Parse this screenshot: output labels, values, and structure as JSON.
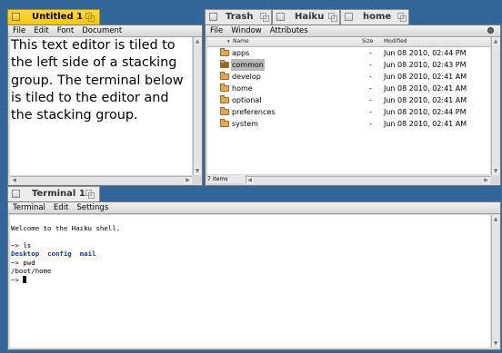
{
  "editor": {
    "tab_title": "Untitled 1",
    "menu": [
      "File",
      "Edit",
      "Font",
      "Document"
    ],
    "text": "This text editor is tiled to the left side of a stacking group. The terminal below is tiled to the editor and the stacking group."
  },
  "tracker": {
    "tabs": [
      "Trash",
      "Haiku",
      "home"
    ],
    "menu": [
      "File",
      "Window",
      "Attributes"
    ],
    "columns": {
      "name": "Name",
      "size": "Size",
      "modified": "Modified"
    },
    "rows": [
      {
        "name": "apps",
        "size": "-",
        "modified": "Jun 08 2010, 02:44 PM",
        "selected": false
      },
      {
        "name": "common",
        "size": "-",
        "modified": "Jun 08 2010, 02:43 PM",
        "selected": true
      },
      {
        "name": "develop",
        "size": "-",
        "modified": "Jun 08 2010, 02:41 AM",
        "selected": false
      },
      {
        "name": "home",
        "size": "-",
        "modified": "Jun 08 2010, 02:41 AM",
        "selected": false
      },
      {
        "name": "optional",
        "size": "-",
        "modified": "Jun 08 2010, 02:41 AM",
        "selected": false
      },
      {
        "name": "preferences",
        "size": "-",
        "modified": "Jun 08 2010, 02:44 PM",
        "selected": false
      },
      {
        "name": "system",
        "size": "-",
        "modified": "Jun 08 2010, 02:41 AM",
        "selected": false
      }
    ],
    "status": "7 items"
  },
  "terminal": {
    "tab_title": "Terminal 1",
    "menu": [
      "Terminal",
      "Edit",
      "Settings"
    ],
    "lines": {
      "welcome": "Welcome to the Haiku shell.",
      "cmd1": "~> ls",
      "ls_out": [
        "Desktop",
        "config",
        "mail"
      ],
      "cmd2": "~> pwd",
      "pwd_out": "/boot/home",
      "prompt": "~> "
    }
  },
  "icons": [
    "close-box-icon",
    "zoom-box-icon",
    "folder-icon",
    "gear-icon",
    "scroll-arrow-icon",
    "sort-arrow-icon"
  ]
}
